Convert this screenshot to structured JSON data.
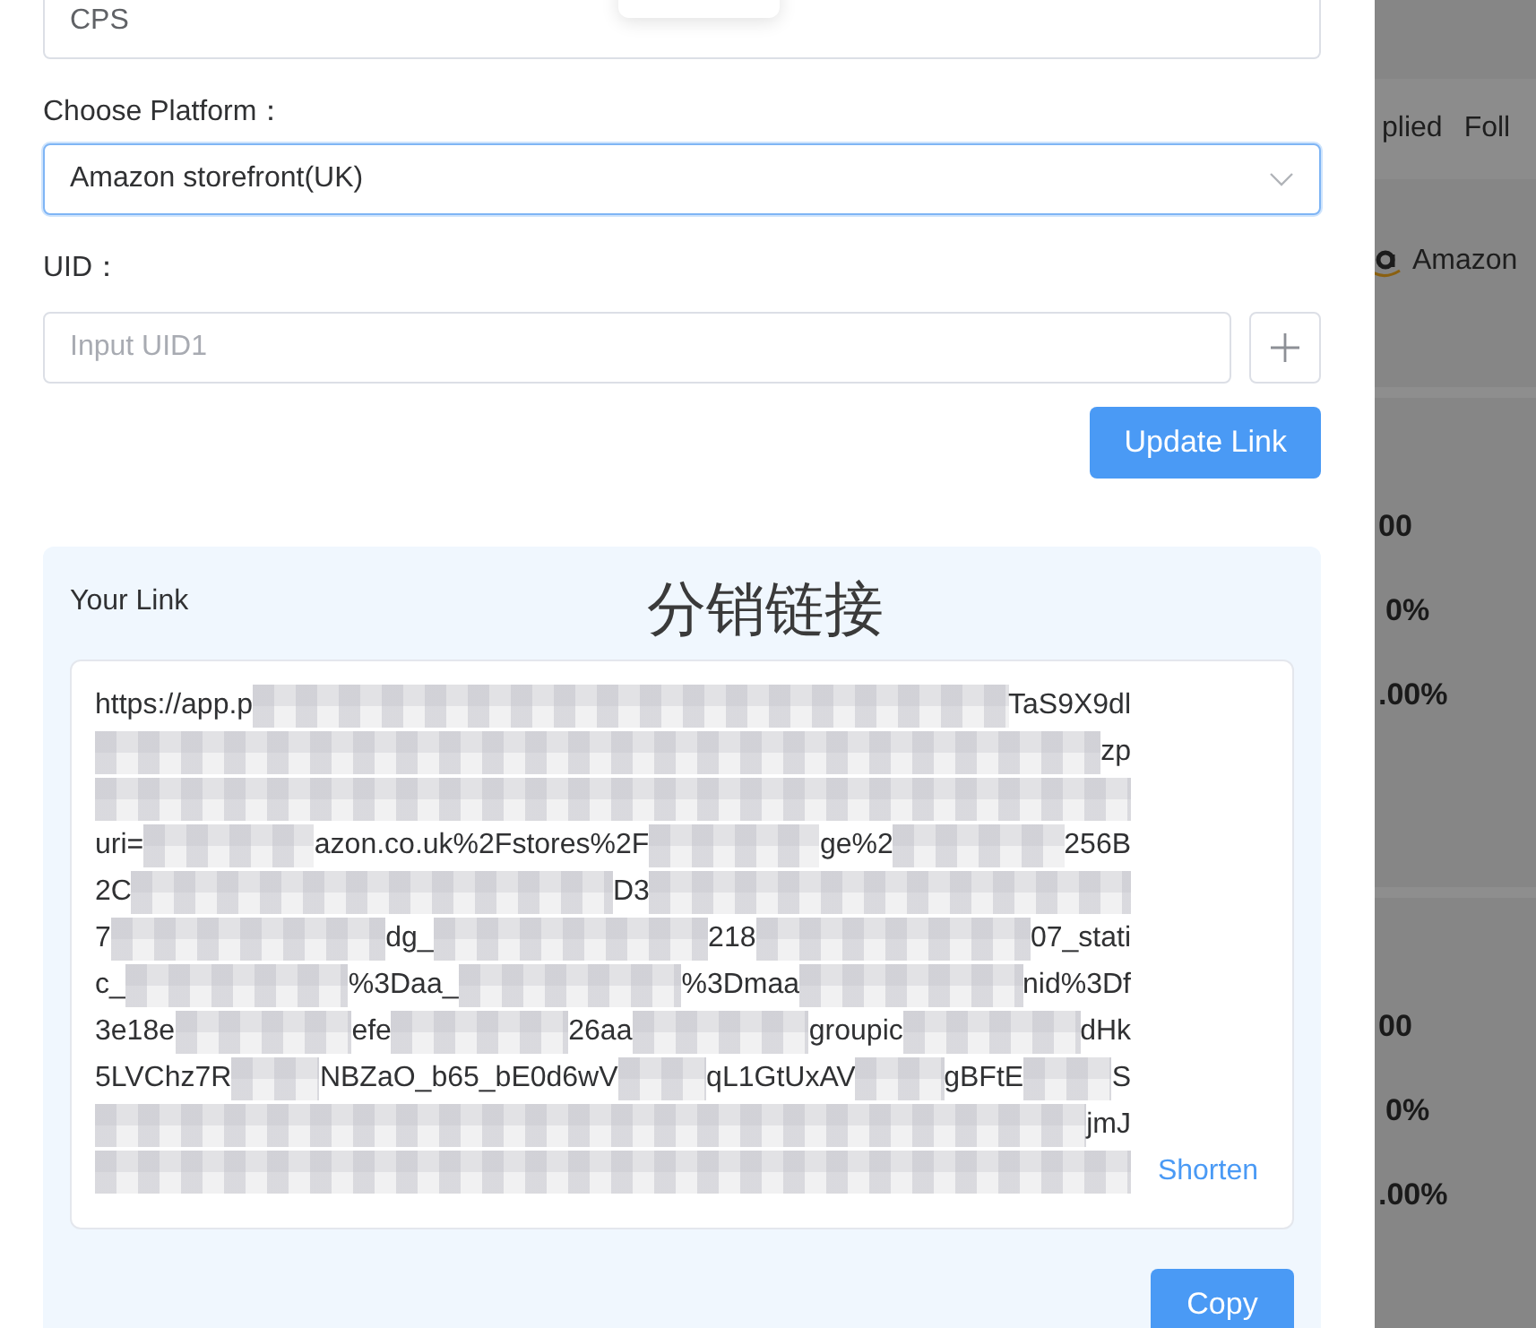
{
  "form": {
    "type_field": {
      "value": "CPS"
    },
    "platform_label": "Choose Platform：",
    "platform_select": {
      "value": "Amazon storefront(UK)",
      "focused": true
    },
    "uid_label": "UID：",
    "uid_inputs": [
      {
        "placeholder": "Input UID1"
      }
    ],
    "update_button": "Update Link"
  },
  "link_card": {
    "title": "Your Link",
    "annotation": "分销链接",
    "lines": [
      [
        {
          "kind": "text",
          "text": "https://app.p"
        },
        {
          "kind": "redacted"
        },
        {
          "kind": "text",
          "text": "TaS9X9dl"
        }
      ],
      [
        {
          "kind": "redacted"
        },
        {
          "kind": "text",
          "text": "zp"
        }
      ],
      [
        {
          "kind": "redacted"
        }
      ],
      [
        {
          "kind": "text",
          "text": "uri="
        },
        {
          "kind": "redacted"
        },
        {
          "kind": "text",
          "text": "azon.co.uk%2Fstores%2F"
        },
        {
          "kind": "redacted"
        },
        {
          "kind": "text",
          "text": "ge%2"
        },
        {
          "kind": "redacted"
        },
        {
          "kind": "text",
          "text": "256B"
        }
      ],
      [
        {
          "kind": "text",
          "text": "2C"
        },
        {
          "kind": "redacted"
        },
        {
          "kind": "text",
          "text": "D3"
        },
        {
          "kind": "redacted"
        }
      ],
      [
        {
          "kind": "text",
          "text": "7"
        },
        {
          "kind": "redacted"
        },
        {
          "kind": "text",
          "text": "dg_"
        },
        {
          "kind": "redacted"
        },
        {
          "kind": "text",
          "text": "218"
        },
        {
          "kind": "redacted"
        },
        {
          "kind": "text",
          "text": "07_stati"
        }
      ],
      [
        {
          "kind": "text",
          "text": "c_"
        },
        {
          "kind": "redacted"
        },
        {
          "kind": "text",
          "text": "%3Daa_"
        },
        {
          "kind": "redacted"
        },
        {
          "kind": "text",
          "text": "%3Dmaa"
        },
        {
          "kind": "redacted"
        },
        {
          "kind": "text",
          "text": "nid%3Df"
        }
      ],
      [
        {
          "kind": "text",
          "text": "3e18e"
        },
        {
          "kind": "redacted"
        },
        {
          "kind": "text",
          "text": "efe"
        },
        {
          "kind": "redacted"
        },
        {
          "kind": "text",
          "text": "26aa"
        },
        {
          "kind": "redacted"
        },
        {
          "kind": "text",
          "text": "groupic"
        },
        {
          "kind": "redacted"
        },
        {
          "kind": "text",
          "text": "dHk"
        }
      ],
      [
        {
          "kind": "text",
          "text": "5LVChz7R"
        },
        {
          "kind": "redacted"
        },
        {
          "kind": "text",
          "text": "NBZaO_b65_bE0d6wV"
        },
        {
          "kind": "redacted"
        },
        {
          "kind": "text",
          "text": "qL1GtUxAV"
        },
        {
          "kind": "redacted"
        },
        {
          "kind": "text",
          "text": "gBFtE"
        },
        {
          "kind": "redacted"
        },
        {
          "kind": "text",
          "text": "S"
        }
      ],
      [
        {
          "kind": "redacted"
        },
        {
          "kind": "text",
          "text": "jmJ"
        }
      ],
      [
        {
          "kind": "redacted"
        }
      ]
    ],
    "shorten": "Shorten",
    "copy_button": "Copy"
  },
  "background_page": {
    "tabs": [
      "plied",
      "Foll"
    ],
    "platform": "Amazon",
    "cards": [
      {
        "values": [
          "00",
          "0%",
          ".00%"
        ]
      },
      {
        "values": [
          "00",
          "0%",
          ".00%"
        ]
      }
    ]
  }
}
